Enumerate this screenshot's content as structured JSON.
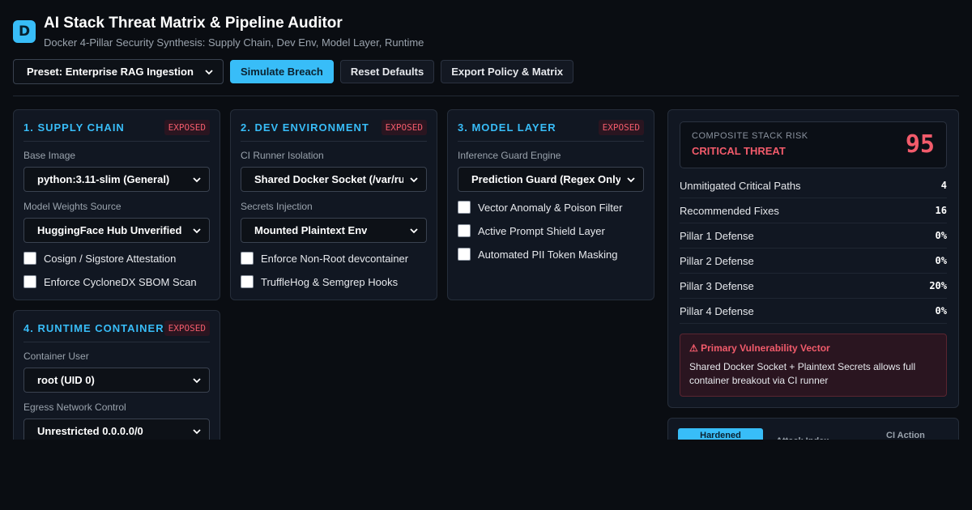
{
  "app": {
    "logo_letter": "D",
    "title": "AI Stack Threat Matrix & Pipeline Auditor",
    "subtitle": "Docker 4-Pillar Security Synthesis: Supply Chain, Dev Env, Model Layer, Runtime"
  },
  "toolbar": {
    "preset_value": "Preset: Enterprise RAG Ingestion",
    "simulate_label": "Simulate Breach",
    "reset_label": "Reset Defaults",
    "export_label": "Export Policy & Matrix"
  },
  "supply_chain": {
    "title": "1. SUPPLY CHAIN",
    "badge": "EXPOSED",
    "base_image_label": "Base Image",
    "base_image_value": "python:3.11-slim (General)",
    "weights_label": "Model Weights Source",
    "weights_value": "HuggingFace Hub Unverified",
    "checks": [
      "Cosign / Sigstore Attestation",
      "Enforce CycloneDX SBOM Scan"
    ]
  },
  "dev_env": {
    "title": "2. DEV ENVIRONMENT",
    "badge": "EXPOSED",
    "runner_label": "CI Runner Isolation",
    "runner_value": "Shared Docker Socket (/var/run/docker.sock)",
    "secrets_label": "Secrets Injection",
    "secrets_value": "Mounted Plaintext Env",
    "checks": [
      "Enforce Non-Root devcontainer",
      "TruffleHog & Semgrep Hooks"
    ]
  },
  "model_layer": {
    "title": "3. MODEL LAYER",
    "badge": "EXPOSED",
    "guard_label": "Inference Guard Engine",
    "guard_value": "Prediction Guard (Regex Only)",
    "checks": [
      "Vector Anomaly & Poison Filter",
      "Active Prompt Shield Layer",
      "Automated PII Token Masking"
    ]
  },
  "runtime": {
    "title": "4. RUNTIME CONTAINER",
    "badge": "EXPOSED",
    "user_label": "Container User",
    "user_value": "root (UID 0)",
    "egress_label": "Egress Network Control",
    "egress_value": "Unrestricted 0.0.0.0/0"
  },
  "risk": {
    "label": "COMPOSITE STACK RISK",
    "status": "CRITICAL THREAT",
    "score": "95",
    "metrics": [
      {
        "label": "Unmitigated Critical Paths",
        "value": "4"
      },
      {
        "label": "Recommended Fixes",
        "value": "16"
      },
      {
        "label": "Pillar 1 Defense",
        "value": "0%"
      },
      {
        "label": "Pillar 2 Defense",
        "value": "0%"
      },
      {
        "label": "Pillar 3 Defense",
        "value": "20%"
      },
      {
        "label": "Pillar 4 Defense",
        "value": "0%"
      }
    ],
    "vuln_title": "⚠ Primary Vulnerability Vector",
    "vuln_text": "Shared Docker Socket + Plaintext Secrets allows full container breakout via CI runner"
  },
  "tabs": [
    "Hardened",
    "Attack Index",
    "CI Action"
  ],
  "colors": {
    "accent": "#38bdf8",
    "danger": "#f25b6b",
    "background": "#0a0d12"
  }
}
